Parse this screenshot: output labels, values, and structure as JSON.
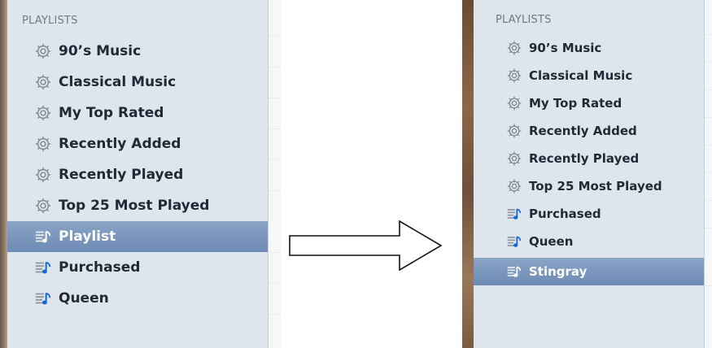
{
  "left_panel": {
    "header": "PLAYLISTS",
    "items": [
      {
        "label": "90’s Music",
        "icon": "gear-icon"
      },
      {
        "label": "Classical Music",
        "icon": "gear-icon"
      },
      {
        "label": "My Top Rated",
        "icon": "gear-icon"
      },
      {
        "label": "Recently Added",
        "icon": "gear-icon"
      },
      {
        "label": "Recently Played",
        "icon": "gear-icon"
      },
      {
        "label": "Top 25 Most Played",
        "icon": "gear-icon"
      },
      {
        "label": "Playlist",
        "icon": "playlist-icon",
        "selected": true
      },
      {
        "label": "Purchased",
        "icon": "playlist-icon"
      },
      {
        "label": "Queen",
        "icon": "playlist-icon"
      }
    ]
  },
  "right_panel": {
    "header": "PLAYLISTS",
    "items": [
      {
        "label": "90’s Music",
        "icon": "gear-icon"
      },
      {
        "label": "Classical Music",
        "icon": "gear-icon"
      },
      {
        "label": "My Top Rated",
        "icon": "gear-icon"
      },
      {
        "label": "Recently Added",
        "icon": "gear-icon"
      },
      {
        "label": "Recently Played",
        "icon": "gear-icon"
      },
      {
        "label": "Top 25 Most Played",
        "icon": "gear-icon"
      },
      {
        "label": "Purchased",
        "icon": "playlist-icon"
      },
      {
        "label": "Queen",
        "icon": "playlist-icon"
      },
      {
        "label": "Stingray",
        "icon": "playlist-icon",
        "selected": true
      }
    ]
  },
  "colors": {
    "selected_top": "#8aa4c6",
    "selected_bottom": "#6d8bb4",
    "sidebar_bg": "#dfe5ed",
    "header_text": "#6e7a88",
    "playlist_note": "#1565d8"
  }
}
